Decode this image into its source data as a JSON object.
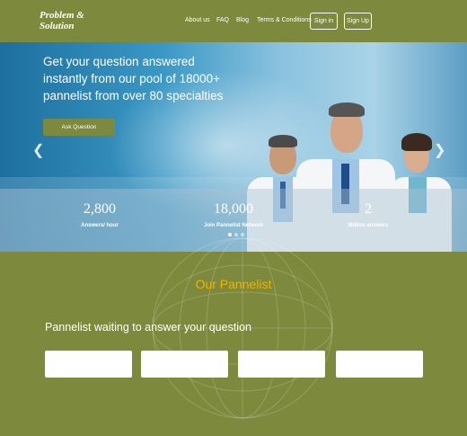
{
  "header": {
    "logo_line1": "Problem &",
    "logo_line2": "Solution",
    "nav": [
      "About us",
      "FAQ",
      "Blog",
      "Terms & Conditions"
    ],
    "sign_in": "Sign in",
    "sign_up": "Sign Up"
  },
  "hero": {
    "headline": "Get your question answered instantly from our pool of 18000+ pannelist from over 80 specialties",
    "ask_button": "Ask Question",
    "stats": [
      {
        "number": "2,800",
        "label": "Answers/ hour"
      },
      {
        "number": "18,000",
        "label": "Join Pannelist Network"
      },
      {
        "number": "2",
        "label": "Million answers"
      }
    ]
  },
  "section": {
    "title": "Our Pannelist",
    "subtitle": "Pannelist waiting to answer your question"
  },
  "colors": {
    "brand_olive": "#7d8a3d",
    "accent_gold": "#f0b400"
  }
}
